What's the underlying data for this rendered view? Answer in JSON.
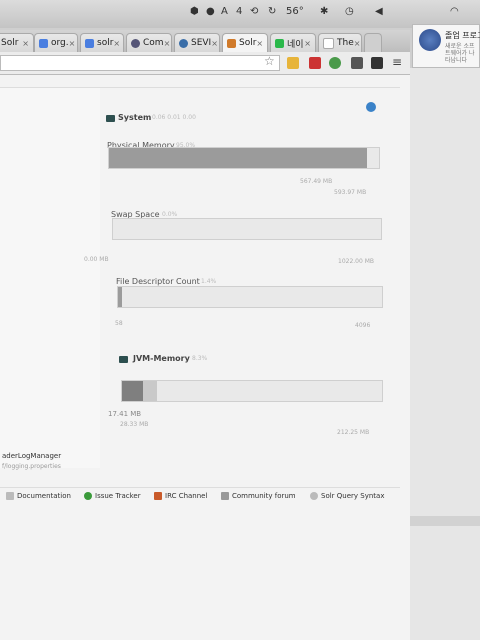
{
  "menubar": {
    "indicator_4": "4",
    "battery": "56°"
  },
  "tabs": [
    {
      "label": "Solr",
      "icon": "solr-icon"
    },
    {
      "label": "org.",
      "icon": "google-icon"
    },
    {
      "label": "solr",
      "icon": "google-icon"
    },
    {
      "label": "Com",
      "icon": "page-icon"
    },
    {
      "label": "SEVI",
      "icon": "wordpress-icon"
    },
    {
      "label": "Solr",
      "icon": "solr-icon"
    },
    {
      "label": "네이",
      "icon": "naver-icon"
    },
    {
      "label": "The",
      "icon": "page-icon"
    }
  ],
  "notification": {
    "title": "졸업 프로그",
    "subtitle": "새로운 소프트웨어가 나타납니다"
  },
  "system": {
    "title": "System",
    "subtitle": "0.06 0.01 0.00",
    "physical_memory": {
      "label": "Physical Memory",
      "percent": "95.0%",
      "used": "567.49 MB",
      "total": "593.97 MB",
      "fill": 0.955
    },
    "swap_space": {
      "label": "Swap Space",
      "percent": "0.0%",
      "used": "0.00 MB",
      "total": "1022.00 MB",
      "fill": 0.0
    },
    "file_descriptor": {
      "label": "File Descriptor Count",
      "percent": "1.4%",
      "used": "58",
      "total": "4096",
      "fill": 0.014
    }
  },
  "jvm": {
    "title": "JVM-Memory",
    "percent": "8.3%",
    "used": "17.41 MB",
    "committed": "28.33 MB",
    "total": "212.25 MB",
    "fill_used": 0.082,
    "fill_committed": 0.133
  },
  "left": {
    "line1": "aderLogManager",
    "line2": "f/logging.properties"
  },
  "footer": {
    "documentation": "Documentation",
    "issue_tracker": "Issue Tracker",
    "irc": "IRC Channel",
    "forum": "Community forum",
    "query_syntax": "Solr Query Syntax"
  },
  "colors": {
    "fill": "#9b9b9b",
    "accent": "#3a82c8"
  }
}
